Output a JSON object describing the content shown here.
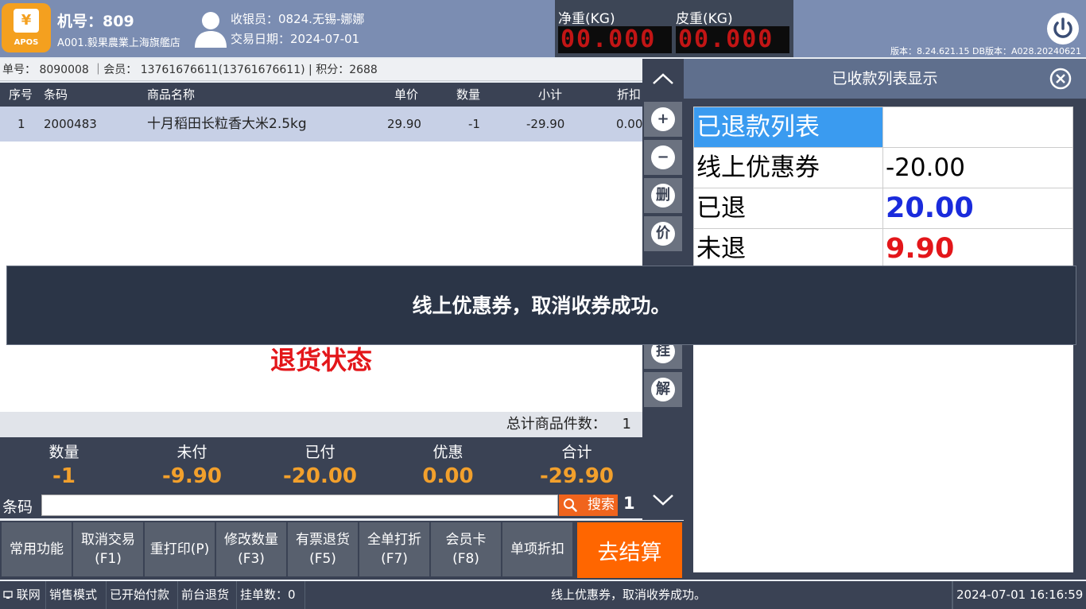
{
  "header": {
    "logo_text": "APOS",
    "logo_symbol": "¥",
    "machine_no": "机号：809",
    "store": "A001.毅果農業上海旗艦店",
    "cashier": "收银员：0824.无锡-娜娜",
    "trade_date": "交易日期：2024-07-01",
    "net_weight_label": "净重(KG)",
    "net_weight_value": "00.000",
    "tare_weight_label": "皮重(KG)",
    "tare_weight_value": "00.000",
    "version": "版本：8.24.621.15 DB版本：A028.20240621"
  },
  "order_info": "单号： 8090008 ｜会员： 13761676611(13761676611) | 积分：2688",
  "table": {
    "columns": [
      "序号",
      "条码",
      "商品名称",
      "单价",
      "数量",
      "小计",
      "折扣"
    ],
    "rows": [
      {
        "seq": "1",
        "barcode": "2000483",
        "name": "十月稻田长粒香大米2.5kg",
        "price": "29.90",
        "qty": "-1",
        "subtotal": "-29.90",
        "discount": "0.00"
      }
    ]
  },
  "return_status": "退货状态",
  "total_items_label": "总计商品件数：",
  "total_items_value": "1",
  "summary": {
    "labels": [
      "数量",
      "未付",
      "已付",
      "优惠",
      "合计"
    ],
    "values": [
      "-1",
      "-9.90",
      "-20.00",
      "0.00",
      "-29.90"
    ]
  },
  "barcode": {
    "label": "条码",
    "value": "",
    "search": "搜索",
    "qty": "1"
  },
  "functions": [
    {
      "line1": "常用功能",
      "line2": ""
    },
    {
      "line1": "取消交易",
      "line2": "(F1)"
    },
    {
      "line1": "重打印(P)",
      "line2": ""
    },
    {
      "line1": "修改数量",
      "line2": "(F3)"
    },
    {
      "line1": "有票退货",
      "line2": "(F5)"
    },
    {
      "line1": "全单打折",
      "line2": "(F7)"
    },
    {
      "line1": "会员卡",
      "line2": "(F8)"
    },
    {
      "line1": "单项折扣",
      "line2": ""
    }
  ],
  "checkout": "去结算",
  "side_buttons": {
    "add": "+",
    "remove": "−",
    "delete": "删",
    "price": "价",
    "hold": "挂",
    "release": "解"
  },
  "panel": {
    "title": "已收款列表显示",
    "rows": [
      {
        "label": "已退款列表",
        "value": ""
      },
      {
        "label": "线上优惠券",
        "value": "-20.00"
      },
      {
        "label": "已退",
        "value": "20.00"
      },
      {
        "label": "未退",
        "value": "9.90"
      }
    ]
  },
  "toast": "线上优惠券，取消收券成功。",
  "status_bar": {
    "network": "联网",
    "mode": "销售模式",
    "pay_started": "已开始付款",
    "front_return": "前台退货",
    "held_count": "挂单数：0",
    "message": "线上优惠券，取消收券成功。",
    "datetime": "2024-07-01 16:16:59"
  },
  "colors": {
    "accent": "#ff6600",
    "header": "#7b8db2",
    "dark": "#3a4254",
    "amount": "#f2a02c",
    "refunded": "#1a2bdc",
    "pending": "#e3161a"
  }
}
